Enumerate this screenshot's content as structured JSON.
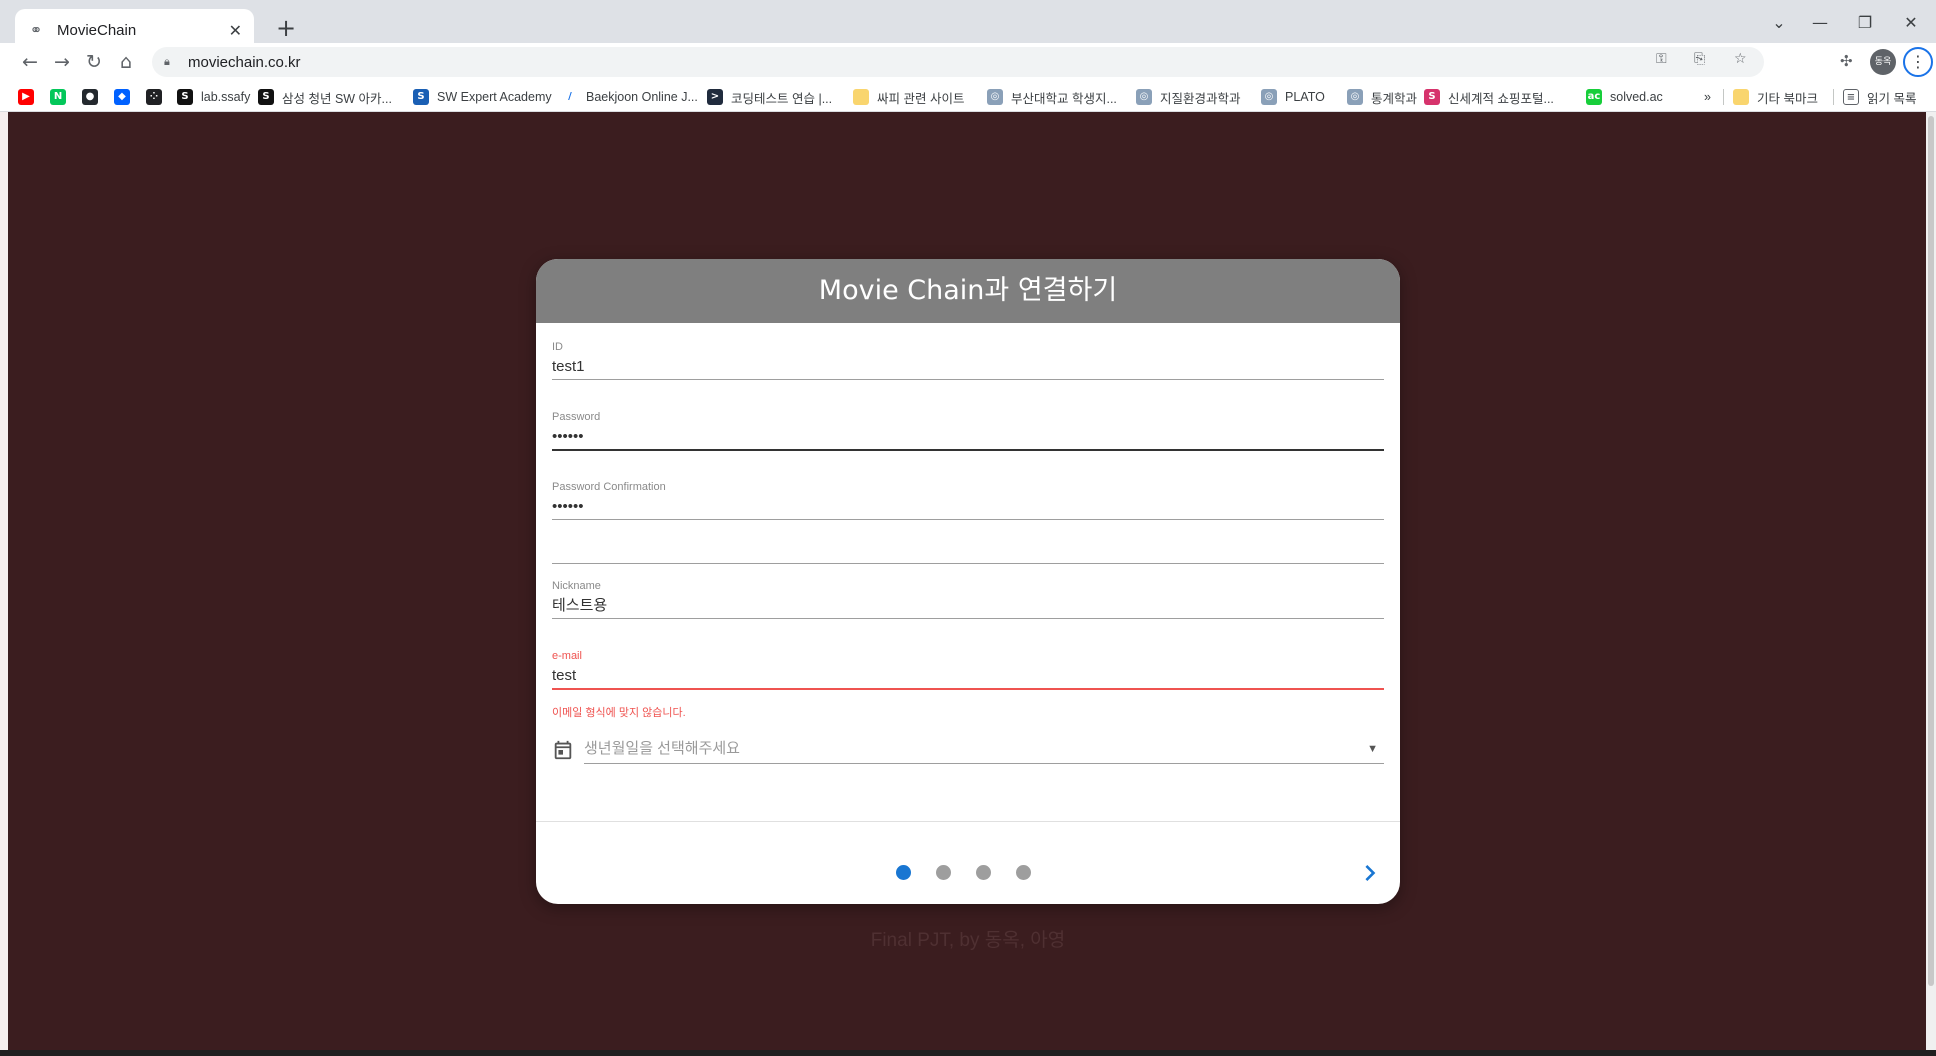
{
  "browser": {
    "tab_title": "MovieChain",
    "tab_close": "✕",
    "new_tab": "+",
    "url": "moviechain.co.kr",
    "profile_initials": "동옥"
  },
  "bookmarks": [
    {
      "label": "",
      "icon": "youtube-icon",
      "color": "#ff0000",
      "glyph": "▶"
    },
    {
      "label": "",
      "icon": "naver-icon",
      "color": "#03c75a",
      "glyph": "N"
    },
    {
      "label": "",
      "icon": "github-icon",
      "color": "#24292e",
      "glyph": "●"
    },
    {
      "label": "",
      "icon": "dropbox-icon",
      "color": "#0061ff",
      "glyph": "◆"
    },
    {
      "label": "",
      "icon": "dots-icon",
      "color": "#202124",
      "glyph": "⁘"
    },
    {
      "label": "lab.ssafy",
      "icon": "ssafy-icon",
      "color": "#111111",
      "glyph": "S"
    },
    {
      "label": "삼성 청년 SW 아카...",
      "icon": "samsung-icon",
      "color": "#111111",
      "glyph": "S"
    },
    {
      "label": "SW Expert Academy",
      "icon": "swea-icon",
      "color": "#1a5fb4",
      "glyph": "S"
    },
    {
      "label": "Baekjoon Online J...",
      "icon": "baekjoon-icon",
      "color": "#ffffff",
      "glyph": "/"
    },
    {
      "label": "코딩테스트 연습 |...",
      "icon": "programmers-icon",
      "color": "#202b3d",
      "glyph": ">"
    },
    {
      "label": "싸피 관련 사이트",
      "icon": "folder-icon",
      "color": "#f9d56e",
      "glyph": ""
    },
    {
      "label": "부산대학교 학생지...",
      "icon": "pnu-icon",
      "color": "#8aa0b8",
      "glyph": "◎"
    },
    {
      "label": "지질환경과학과",
      "icon": "pnu-icon",
      "color": "#8aa0b8",
      "glyph": "◎"
    },
    {
      "label": "PLATO",
      "icon": "pnu-icon",
      "color": "#8aa0b8",
      "glyph": "◎"
    },
    {
      "label": "통계학과",
      "icon": "pnu-icon",
      "color": "#8aa0b8",
      "glyph": "◎"
    },
    {
      "label": "신세계적 쇼핑포털...",
      "icon": "ssg-icon",
      "color": "#d6336c",
      "glyph": "S"
    },
    {
      "label": "solved.ac",
      "icon": "solvedac-icon",
      "color": "#17ce3a",
      "glyph": "ac"
    }
  ],
  "bookmarks_more": "»",
  "other_bookmarks": "기타 북마크",
  "reading_list": "읽기 목록",
  "form": {
    "title": "Movie Chain과 연결하기",
    "id_label": "ID",
    "id_value": "test1",
    "password_label": "Password",
    "password_value": "••••••",
    "password_confirm_label": "Password Confirmation",
    "password_confirm_value": "••••••",
    "nickname_label": "Nickname",
    "nickname_value": "테스트용",
    "email_label": "e-mail",
    "email_value": "test",
    "email_error": "이메일 형식에 맞지 않습니다.",
    "birthday_placeholder": "생년월일을 선택해주세요",
    "step_current": 1,
    "step_total": 4
  },
  "footer": "Final PJT, by 동옥, 아영",
  "colors": {
    "background": "#3b1d1f",
    "header": "#7f7f7f",
    "accent": "#1976d2",
    "error": "#ef5350"
  }
}
